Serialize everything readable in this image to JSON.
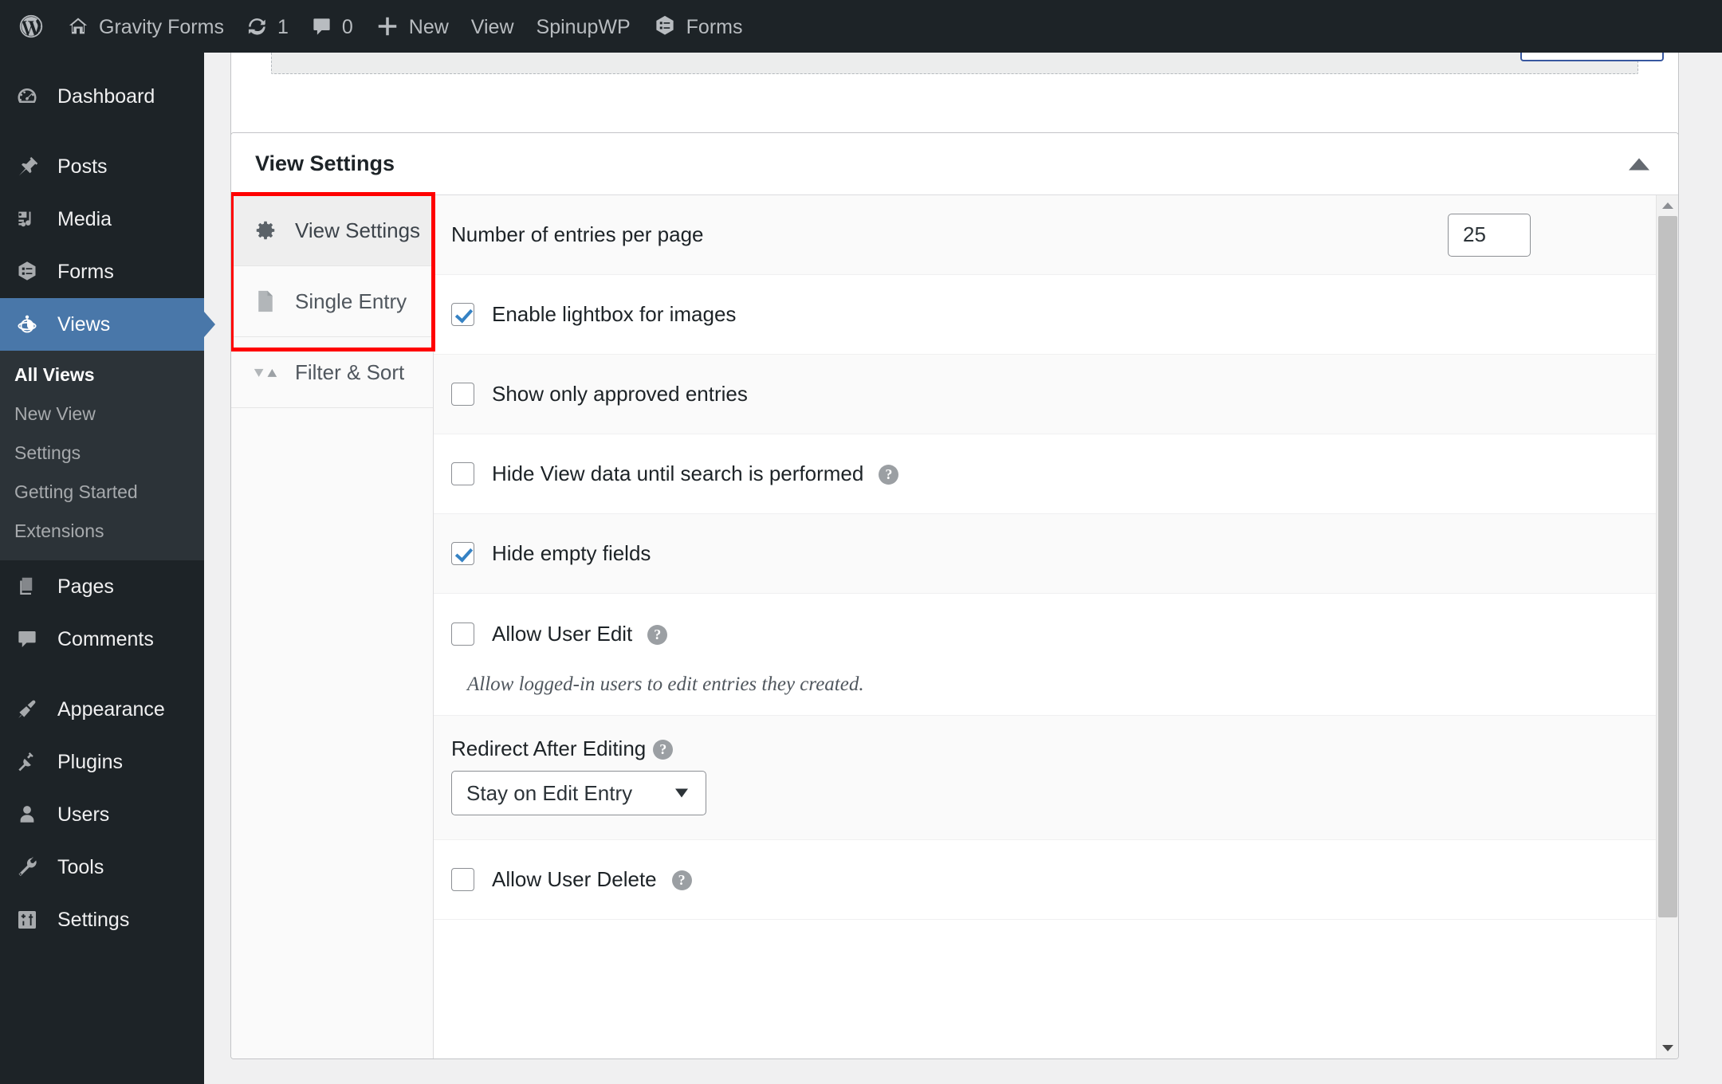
{
  "adminbar": {
    "items": [
      {
        "icon": "wordpress-logo-icon",
        "label": ""
      },
      {
        "icon": "home-icon",
        "label": "Gravity Forms"
      },
      {
        "icon": "updates-icon",
        "label": "1"
      },
      {
        "icon": "comment-bubble-icon",
        "label": "0"
      },
      {
        "icon": "plus-icon",
        "label": "New"
      },
      {
        "icon": "",
        "label": "View"
      },
      {
        "icon": "",
        "label": "SpinupWP"
      },
      {
        "icon": "forms-icon",
        "label": "Forms"
      }
    ]
  },
  "sidebar": {
    "items": [
      {
        "label": "Dashboard",
        "icon": "dashboard-icon",
        "current": false
      },
      {
        "label": "Posts",
        "icon": "pin-icon",
        "current": false
      },
      {
        "label": "Media",
        "icon": "media-icon",
        "current": false
      },
      {
        "label": "Forms",
        "icon": "forms-icon",
        "current": false
      },
      {
        "label": "Views",
        "icon": "views-icon",
        "current": true
      },
      {
        "label": "Pages",
        "icon": "pages-icon",
        "current": false
      },
      {
        "label": "Comments",
        "icon": "comment-bubble-icon",
        "current": false
      },
      {
        "label": "Appearance",
        "icon": "appearance-icon",
        "current": false
      },
      {
        "label": "Plugins",
        "icon": "plugins-icon",
        "current": false
      },
      {
        "label": "Users",
        "icon": "users-icon",
        "current": false
      },
      {
        "label": "Tools",
        "icon": "tools-icon",
        "current": false
      },
      {
        "label": "Settings",
        "icon": "settings-icon",
        "current": false
      }
    ],
    "submenu": [
      {
        "label": "All Views",
        "current": true
      },
      {
        "label": "New View",
        "current": false
      },
      {
        "label": "Settings",
        "current": false
      },
      {
        "label": "Getting Started",
        "current": false
      },
      {
        "label": "Extensions",
        "current": false
      }
    ]
  },
  "metabox": {
    "title": "View Settings",
    "toggle_icon": "triangle-up-icon",
    "tabs": [
      {
        "label": "View Settings",
        "icon": "gear-icon",
        "active": true
      },
      {
        "label": "Single Entry",
        "icon": "document-icon",
        "active": false
      },
      {
        "label": "Filter & Sort",
        "icon": "sort-arrows-icon",
        "active": false
      }
    ],
    "settings": {
      "entries_per_page": {
        "label": "Number of entries per page",
        "value": "25"
      },
      "enable_lightbox": {
        "label": "Enable lightbox for images",
        "checked": true
      },
      "show_only_approved": {
        "label": "Show only approved entries",
        "checked": false
      },
      "hide_view_data": {
        "label": "Hide View data until search is performed",
        "checked": false,
        "help": "?"
      },
      "hide_empty_fields": {
        "label": "Hide empty fields",
        "checked": true
      },
      "allow_user_edit": {
        "label": "Allow User Edit",
        "checked": false,
        "help": "?",
        "description": "Allow logged-in users to edit entries they created."
      },
      "redirect_after_editing": {
        "label": "Redirect After Editing",
        "help": "?",
        "value": "Stay on Edit Entry"
      },
      "allow_user_delete": {
        "label": "Allow User Delete",
        "checked": false,
        "help": "?"
      }
    }
  },
  "colors": {
    "accent_blue": "#4977a9",
    "highlight_red": "#ff0000",
    "admin_dark": "#1d2327",
    "checkbox_check": "#3582c4"
  }
}
